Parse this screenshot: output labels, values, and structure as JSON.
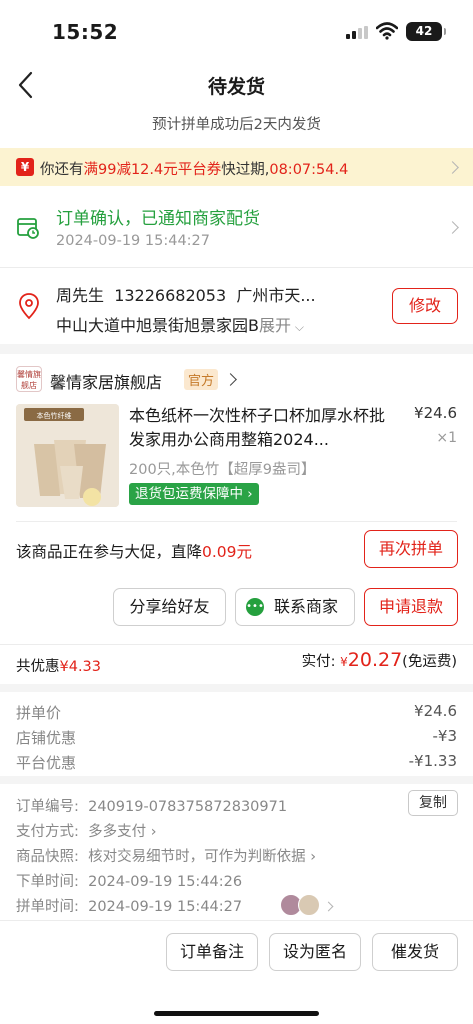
{
  "status_bar": {
    "time": "15:52",
    "battery": "42"
  },
  "header": {
    "title": "待发货",
    "subtitle": "预计拼单成功后2天内发货"
  },
  "coupon": {
    "icon": "yuan-coupon-icon",
    "prefix": "你还有",
    "highlight": "满99减12.4元平台券",
    "middle": "快过期,",
    "countdown": "08:07:54.4"
  },
  "order_status": {
    "title": "订单确认，已通知商家配货",
    "time": "2024-09-19 15:44:27"
  },
  "address": {
    "name": "周先生",
    "phone": "13226682053",
    "city": "广州市天...",
    "detail": "中山大道中旭景街旭景家园B",
    "expand": "展开",
    "modify": "修改"
  },
  "shop": {
    "logo_text": "馨情旗舰店",
    "name": "馨情家居旗舰店",
    "badge": "官方"
  },
  "product": {
    "title": "本色纸杯一次性杯子口杯加厚水杯批发家用办公商用整箱2024...",
    "price": "¥24.6",
    "qty": "×1",
    "spec": "200只,本色竹【超厚9盎司】",
    "guarantee": "退货包运费保障中",
    "image_label": "本色竹纤维"
  },
  "promo": {
    "prefix": "该商品正在参与大促，直降",
    "amount": "0.09元"
  },
  "buttons": {
    "regroup": "再次拼单",
    "share": "分享给好友",
    "contact": "联系商家",
    "refund": "申请退款"
  },
  "totals": {
    "discount_label": "共优惠",
    "discount": "¥4.33",
    "actual_label": "实付:",
    "currency": "¥",
    "actual": "20.27",
    "shipping": "(免运费)"
  },
  "price_details": [
    {
      "label": "拼单价",
      "value": "¥24.6"
    },
    {
      "label": "店铺优惠",
      "value": "-¥3"
    },
    {
      "label": "平台优惠",
      "value": "-¥1.33"
    }
  ],
  "order_info": {
    "order_no_label": "订单编号:",
    "order_no": "240919-078375872830971",
    "copy": "复制",
    "pay_label": "支付方式:",
    "pay": "多多支付",
    "snapshot_label": "商品快照:",
    "snapshot": "核对交易细节时，可作为判断依据",
    "order_time_label": "下单时间:",
    "order_time": "2024-09-19 15:44:26",
    "group_time_label": "拼单时间:",
    "group_time": "2024-09-19 15:44:27"
  },
  "bottom": {
    "note": "订单备注",
    "anonymous": "设为匿名",
    "urge": "催发货"
  }
}
